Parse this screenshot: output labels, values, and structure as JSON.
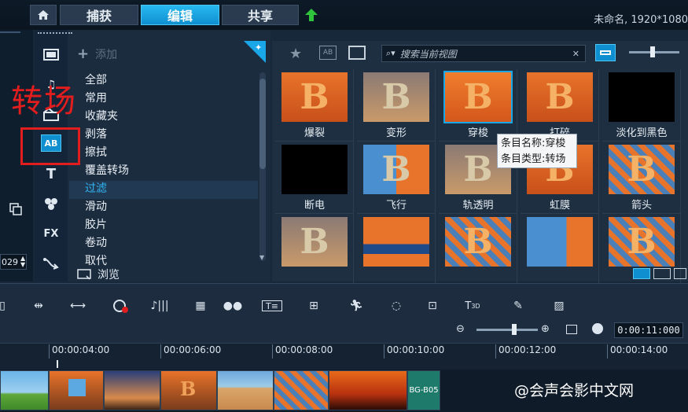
{
  "tabs": [
    {
      "label": "捕获"
    },
    {
      "label": "编辑"
    },
    {
      "label": "共享"
    }
  ],
  "project_title": "未命名, 1920*1080",
  "library": {
    "add_label": "添加",
    "browse_label": "浏览",
    "categories": [
      "全部",
      "常用",
      "收藏夹",
      "剥落",
      "擦拭",
      "覆盖转场",
      "过滤",
      "滑动",
      "胶片",
      "卷动",
      "取代"
    ],
    "selected_category": "过滤"
  },
  "annotation": {
    "text": "转场"
  },
  "left_panel": {
    "stepper_value": "029"
  },
  "search": {
    "placeholder": "搜索当前视图"
  },
  "gallery_items": [
    {
      "name": "爆裂"
    },
    {
      "name": "变形"
    },
    {
      "name": "穿梭"
    },
    {
      "name": "打碎"
    },
    {
      "name": "淡化到黑色"
    },
    {
      "name": "断电"
    },
    {
      "name": "飞行"
    },
    {
      "name": "轨透明"
    },
    {
      "name": "虹膜"
    },
    {
      "name": "箭头"
    },
    {
      "name": ""
    },
    {
      "name": ""
    },
    {
      "name": ""
    },
    {
      "name": ""
    },
    {
      "name": ""
    }
  ],
  "tooltip": {
    "line1": "条目名称:穿梭",
    "line2": "条目类型:转场"
  },
  "timeline": {
    "timecode": "0:00:11:000",
    "ruler_ticks": [
      "00:00:04:00",
      "00:00:06:00",
      "00:00:08:00",
      "00:00:10:00",
      "00:00:12:00",
      "00:00:14:00"
    ],
    "last_clip_label": "BG-B05"
  },
  "watermark": "@会声会影中文网",
  "colors": {
    "accent": "#1aa7e8",
    "annotation_red": "#e11d1d"
  }
}
